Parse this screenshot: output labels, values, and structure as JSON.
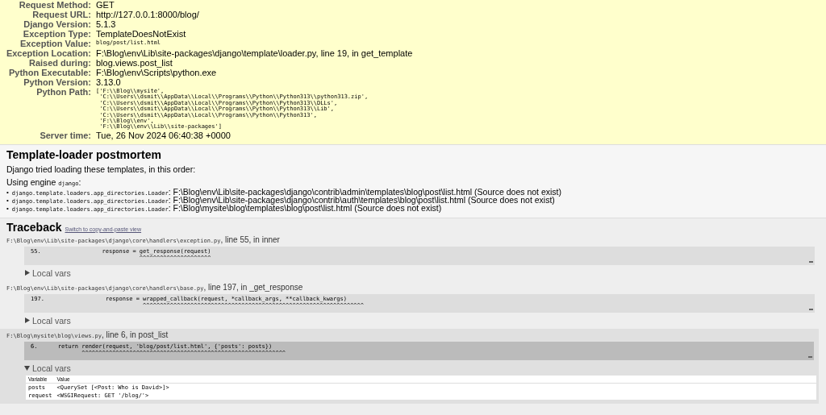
{
  "summary": [
    {
      "label": "Request Method:",
      "value": "GET",
      "mono": false
    },
    {
      "label": "Request URL:",
      "value": "http://127.0.0.1:8000/blog/",
      "mono": false
    },
    {
      "label": "Django Version:",
      "value": "5.1.3",
      "mono": false
    },
    {
      "label": "Exception Type:",
      "value": "TemplateDoesNotExist",
      "mono": false
    },
    {
      "label": "Exception Value:",
      "value": "blog/post/list.html",
      "mono": true
    },
    {
      "label": "Exception Location:",
      "value": "F:\\Blog\\env\\Lib\\site-packages\\django\\template\\loader.py, line 19, in get_template",
      "mono": false
    },
    {
      "label": "Raised during:",
      "value": "blog.views.post_list",
      "mono": false
    },
    {
      "label": "Python Executable:",
      "value": "F:\\Blog\\env\\Scripts\\python.exe",
      "mono": false
    },
    {
      "label": "Python Version:",
      "value": "3.13.0",
      "mono": false
    },
    {
      "label": "Python Path:",
      "value": "['F:\\\\Blog\\\\mysite',\n 'C:\\\\Users\\\\dsmit\\\\AppData\\\\Local\\\\Programs\\\\Python\\\\Python313\\\\python313.zip',\n 'C:\\\\Users\\\\dsmit\\\\AppData\\\\Local\\\\Programs\\\\Python\\\\Python313\\\\DLLs',\n 'C:\\\\Users\\\\dsmit\\\\AppData\\\\Local\\\\Programs\\\\Python\\\\Python313\\\\Lib',\n 'C:\\\\Users\\\\dsmit\\\\AppData\\\\Local\\\\Programs\\\\Python\\\\Python313',\n 'F:\\\\Blog\\\\env',\n 'F:\\\\Blog\\\\env\\\\Lib\\\\site-packages']",
      "mono": true
    },
    {
      "label": "Server time:",
      "value": "Tue, 26 Nov 2024 06:40:38 +0000",
      "mono": false
    }
  ],
  "postmortem": {
    "title": "Template-loader postmortem",
    "intro": "Django tried loading these templates, in this order:",
    "engine_label": "Using engine",
    "engine": "django",
    "engine_suffix": ":",
    "loaders": [
      {
        "bullet": "•",
        "loader": "django.template.loaders.app_directories.Loader",
        "detail": ": F:\\Blog\\env\\Lib\\site-packages\\django\\contrib\\admin\\templates\\blog\\post\\list.html (Source does not exist)"
      },
      {
        "bullet": "•",
        "loader": "django.template.loaders.app_directories.Loader",
        "detail": ": F:\\Blog\\env\\Lib\\site-packages\\django\\contrib\\auth\\templates\\blog\\post\\list.html (Source does not exist)"
      },
      {
        "bullet": "•",
        "loader": "django.template.loaders.app_directories.Loader",
        "detail": ": F:\\Blog\\mysite\\blog\\templates\\blog\\post\\list.html (Source does not exist)"
      }
    ]
  },
  "traceback": {
    "title": "Traceback",
    "switch_link": "Switch to copy-and-paste view",
    "frames": [
      {
        "kind": "django",
        "file": "F:\\Blog\\env\\Lib\\site-packages\\django\\core\\handlers\\exception.py",
        "where": ", line 55, in inner",
        "lineno": "55.",
        "code": "                response = get_response(request)",
        "carets": "                           ^^^^^^^^^^^^^^^^^^^^^",
        "vars_label": "Local vars",
        "expanded": false
      },
      {
        "kind": "django",
        "file": "F:\\Blog\\env\\Lib\\site-packages\\django\\core\\handlers\\base.py",
        "where": ", line 197, in _get_response",
        "lineno": "197.",
        "code": "                response = wrapped_callback(request, *callback_args, **callback_kwargs)",
        "carets": "                           ^^^^^^^^^^^^^^^^^^^^^^^^^^^^^^^^^^^^^^^^^^^^^^^^^^^^^^^^^^^^^^^^^",
        "vars_label": "Local vars",
        "expanded": false
      },
      {
        "kind": "user",
        "file": "F:\\Blog\\mysite\\blog\\views.py",
        "where": ", line 6, in post_list",
        "lineno": "6.",
        "code": "    return render(request, 'blog/post/list.html', {'posts': posts})",
        "carets": "           ^^^^^^^^^^^^^^^^^^^^^^^^^^^^^^^^^^^^^^^^^^^^^^^^^^^^^^^^^^^^",
        "vars_label": "Local vars",
        "expanded": true,
        "var_columns": [
          "Variable",
          "Value"
        ],
        "vars": [
          {
            "name": "posts",
            "value": "<QuerySet [<Post: Who is David>]>"
          },
          {
            "name": "request",
            "value": "<WSGIRequest: GET '/blog/'>"
          }
        ]
      }
    ]
  }
}
